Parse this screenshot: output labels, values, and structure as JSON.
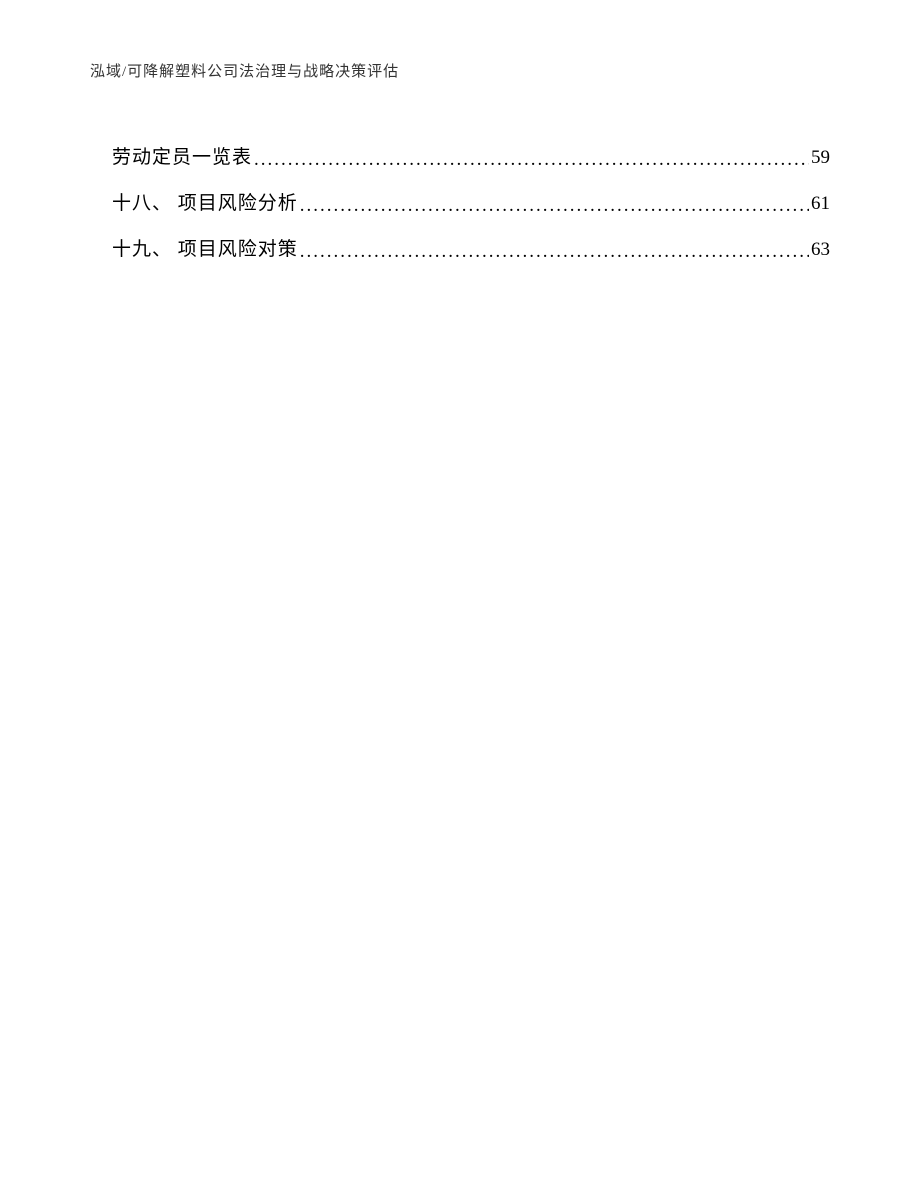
{
  "header": "泓域/可降解塑料公司法治理与战略决策评估",
  "toc": [
    {
      "label": "劳动定员一览表",
      "page": "59"
    },
    {
      "label": "十八、 项目风险分析",
      "page": "61"
    },
    {
      "label": "十九、 项目风险对策",
      "page": "63"
    }
  ]
}
